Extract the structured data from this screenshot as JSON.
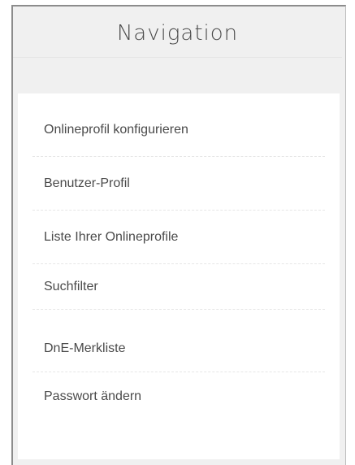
{
  "navigation": {
    "title": "Navigation",
    "items": [
      {
        "label": "Onlineprofil konfigurieren"
      },
      {
        "label": "Benutzer-Profil"
      },
      {
        "label": "Liste Ihrer Onlineprofile"
      },
      {
        "label": "Suchfilter"
      },
      {
        "label": "DnE-Merkliste"
      },
      {
        "label": "Passwort ändern"
      }
    ]
  }
}
